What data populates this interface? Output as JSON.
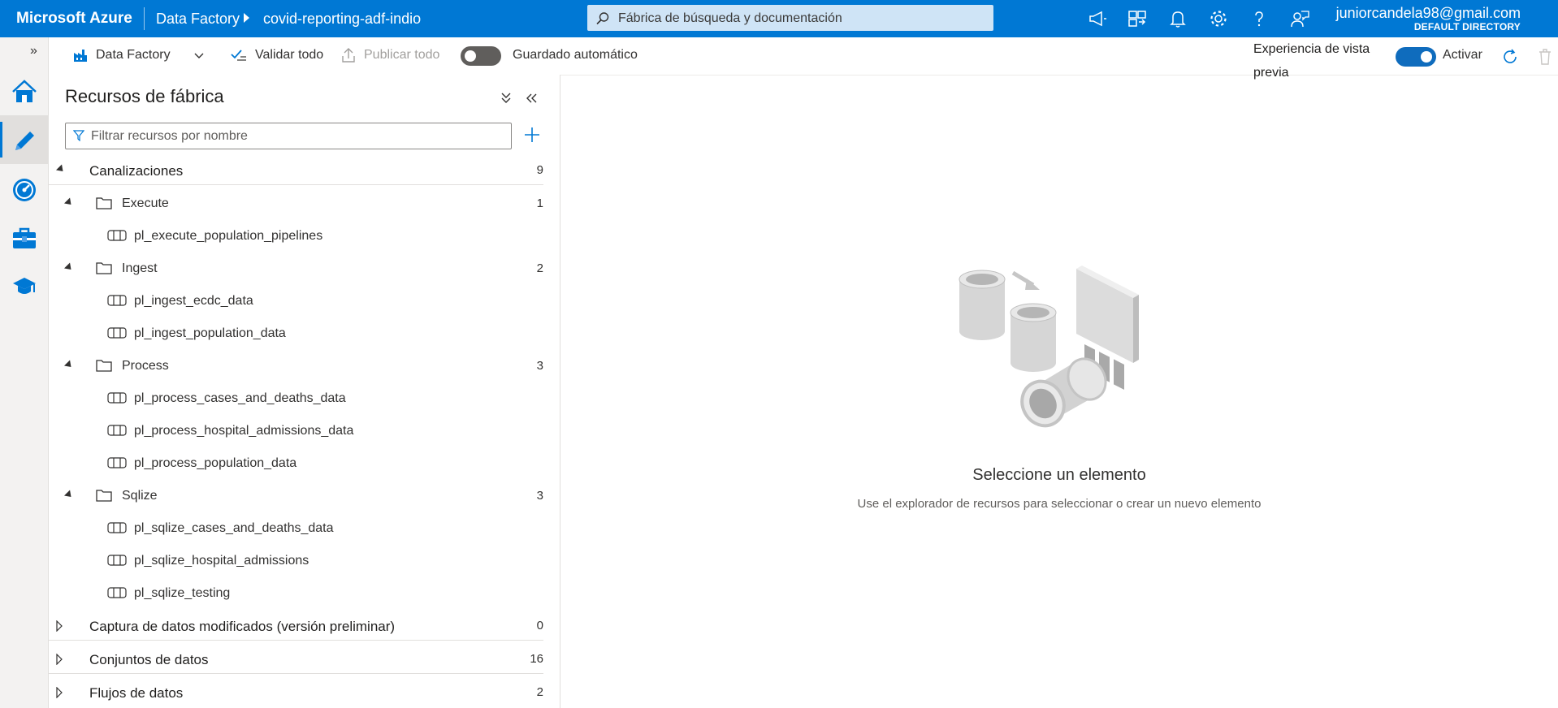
{
  "topbar": {
    "brand": "Microsoft Azure",
    "breadcrumb_service": "Data Factory",
    "breadcrumb_resource": "covid-reporting-adf-indio",
    "search_placeholder": "Fábrica de búsqueda y documentación",
    "account_email": "juniorcandela98@gmail.com",
    "account_directory": "DEFAULT DIRECTORY",
    "icons": [
      "megaphone-icon",
      "switch-directory-icon",
      "bell-icon",
      "gear-icon",
      "help-icon",
      "feedback-icon"
    ]
  },
  "rail": {
    "items": [
      "home-icon",
      "author-pencil-icon",
      "monitor-gauge-icon",
      "manage-toolbox-icon",
      "learning-center-icon"
    ],
    "active": "author-pencil-icon"
  },
  "toolbar": {
    "factory_label": "Data Factory",
    "validate_label": "Validar todo",
    "publish_label": "Publicar todo",
    "autosave_label": "Guardado automático",
    "autosave_on": false,
    "preview_label": "Experiencia de vista previa",
    "preview_toggle_label": "Activar",
    "preview_on": true
  },
  "panel": {
    "title": "Recursos de fábrica",
    "filter_placeholder": "Filtrar recursos por nombre",
    "categories": [
      {
        "label": "Canalizaciones",
        "count": "9",
        "expanded": true
      },
      {
        "label": "Captura de datos modificados (versión preliminar)",
        "count": "0",
        "expanded": false
      },
      {
        "label": "Conjuntos de datos",
        "count": "16",
        "expanded": false
      },
      {
        "label": "Flujos de datos",
        "count": "2",
        "expanded": false
      }
    ],
    "folders": [
      {
        "name": "Execute",
        "count": "1",
        "pipelines": [
          "pl_execute_population_pipelines"
        ]
      },
      {
        "name": "Ingest",
        "count": "2",
        "pipelines": [
          "pl_ingest_ecdc_data",
          "pl_ingest_population_data"
        ]
      },
      {
        "name": "Process",
        "count": "3",
        "pipelines": [
          "pl_process_cases_and_deaths_data",
          "pl_process_hospital_admissions_data",
          "pl_process_population_data"
        ]
      },
      {
        "name": "Sqlize",
        "count": "3",
        "pipelines": [
          "pl_sqlize_cases_and_deaths_data",
          "pl_sqlize_hospital_admissions",
          "pl_sqlize_testing"
        ]
      }
    ]
  },
  "empty_state": {
    "title": "Seleccione un elemento",
    "subtitle": "Use el explorador de recursos para seleccionar o crear un nuevo elemento"
  }
}
